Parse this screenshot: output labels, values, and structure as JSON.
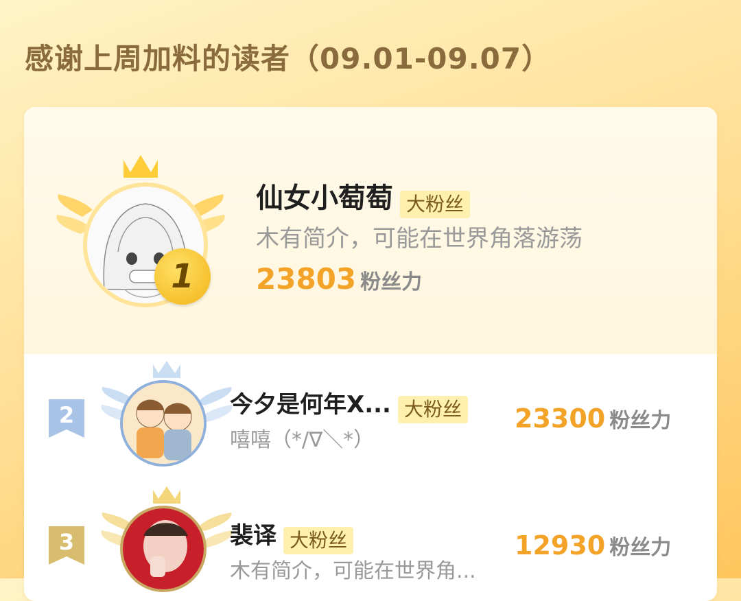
{
  "header": {
    "title": "感谢上周加料的读者（09.01-09.07）"
  },
  "ranks": [
    {
      "rank": "1",
      "name": "仙女小萄萄",
      "badge": "大粉丝",
      "bio": "木有简介，可能在世界角落游荡",
      "score": "23803",
      "score_unit": "粉丝力"
    },
    {
      "rank": "2",
      "name": "今夕是何年X...",
      "badge": "大粉丝",
      "bio": "嘻嘻（*/∇＼*）",
      "score": "23300",
      "score_unit": "粉丝力"
    },
    {
      "rank": "3",
      "name": "裴译",
      "badge": "大粉丝",
      "bio": "木有简介，可能在世界角...",
      "score": "12930",
      "score_unit": "粉丝力"
    }
  ],
  "colors": {
    "accent": "#f3a328",
    "badge_bg": "#fff0b0",
    "gold": "#f5c230",
    "silver": "#9fbfe2",
    "bronze": "#d8bb69"
  }
}
